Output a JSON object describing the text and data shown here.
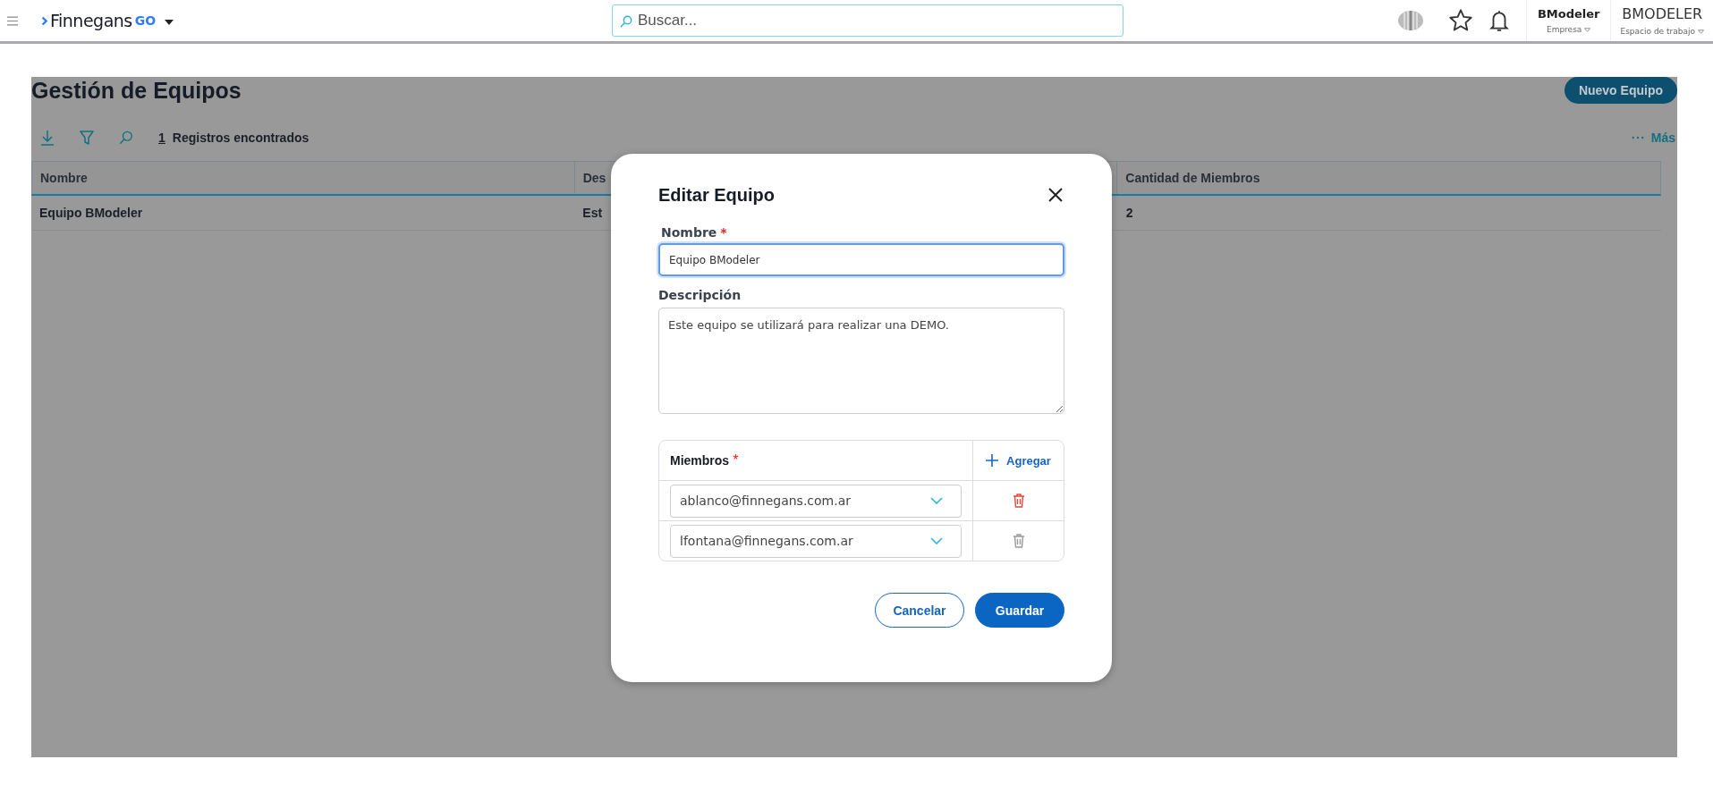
{
  "topbar": {
    "brand": "Finnegans",
    "brand_suffix": "GO",
    "search": {
      "placeholder": "Buscar..."
    },
    "company": {
      "name": "BModeler",
      "label": "Empresa"
    },
    "workspace": {
      "name": "BMODELER",
      "label": "Espacio de trabajo"
    }
  },
  "page": {
    "title": "Gestión de Equipos",
    "new_button": "Nuevo Equipo",
    "record_count": "1",
    "record_label": "Registros encontrados",
    "more": "Más"
  },
  "table": {
    "columns": [
      "Nombre",
      "Des",
      "Cantidad de Miembros"
    ],
    "rows": [
      [
        "Equipo BModeler",
        "Est",
        "2"
      ]
    ]
  },
  "dialog": {
    "title": "Editar Equipo",
    "name_field": {
      "label": "Nombre",
      "required_mark": "*",
      "value": "Equipo BModeler"
    },
    "description_field": {
      "label": "Descripción",
      "value": "Este equipo se utilizará para realizar una DEMO."
    },
    "members": {
      "label": "Miembros",
      "required_mark": "*",
      "add_button": "Agregar",
      "rows": [
        {
          "email": "ablanco@finnegans.com.ar",
          "hovered": true
        },
        {
          "email": "lfontana@finnegans.com.ar",
          "hovered": false
        }
      ]
    },
    "cancel_button": "Cancelar",
    "save_button": "Guardar"
  }
}
